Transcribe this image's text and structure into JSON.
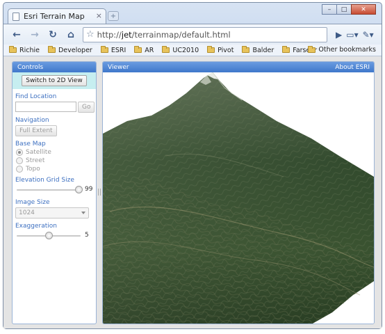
{
  "browser": {
    "tab_title": "Esri Terrain Map",
    "url_prefix": "http://",
    "url_host": "jet",
    "url_path": "/terrainmap/default.html",
    "bookmarks": [
      "Richie",
      "Developer",
      "ESRI",
      "AR",
      "UC2010",
      "Pivot",
      "Balder",
      "Farseer"
    ],
    "other_bookmarks": "Other bookmarks"
  },
  "controls": {
    "title": "Controls",
    "switch_label": "Switch to 2D View",
    "find_label": "Find Location",
    "find_value": "",
    "go_label": "Go",
    "navigation_label": "Navigation",
    "full_extent_label": "Full Extent",
    "basemap_label": "Base Map",
    "basemap_options": [
      "Satellite",
      "Street",
      "Topo"
    ],
    "basemap_selected": "Satellite",
    "grid_label": "Elevation Grid Size",
    "grid_value": "99",
    "grid_fraction": 0.97,
    "image_size_label": "Image Size",
    "image_size_value": "1024",
    "exaggeration_label": "Exaggeration",
    "exaggeration_value": "5",
    "exaggeration_fraction": 0.5
  },
  "viewer": {
    "title": "Viewer",
    "about_label": "About ESRI"
  },
  "colors": {
    "panel_header": "#4a82d4",
    "section_label": "#3c6fc0",
    "switch_band": "#c6eef0"
  }
}
